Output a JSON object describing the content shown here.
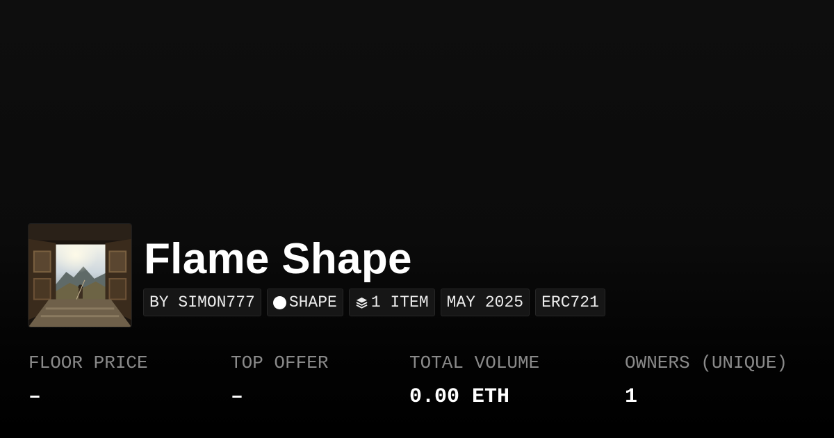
{
  "collection": {
    "name": "Flame Shape",
    "thumbnail_alt": "Collection artwork"
  },
  "tags": {
    "creator": "BY SIMON777",
    "chain": "SHAPE",
    "chain_icon": "circle-icon",
    "items": "1 ITEM",
    "items_icon": "layers-icon",
    "date": "MAY 2025",
    "standard": "ERC721"
  },
  "stats": [
    {
      "label": "FLOOR PRICE",
      "value": "–"
    },
    {
      "label": "TOP OFFER",
      "value": "–"
    },
    {
      "label": "TOTAL VOLUME",
      "value": "0.00 ETH"
    },
    {
      "label": "OWNERS (UNIQUE)",
      "value": "1"
    }
  ],
  "colors": {
    "background": "#0b0b0b",
    "tag_background": "#161616",
    "label": "#8a8a8a",
    "text": "#ffffff"
  }
}
